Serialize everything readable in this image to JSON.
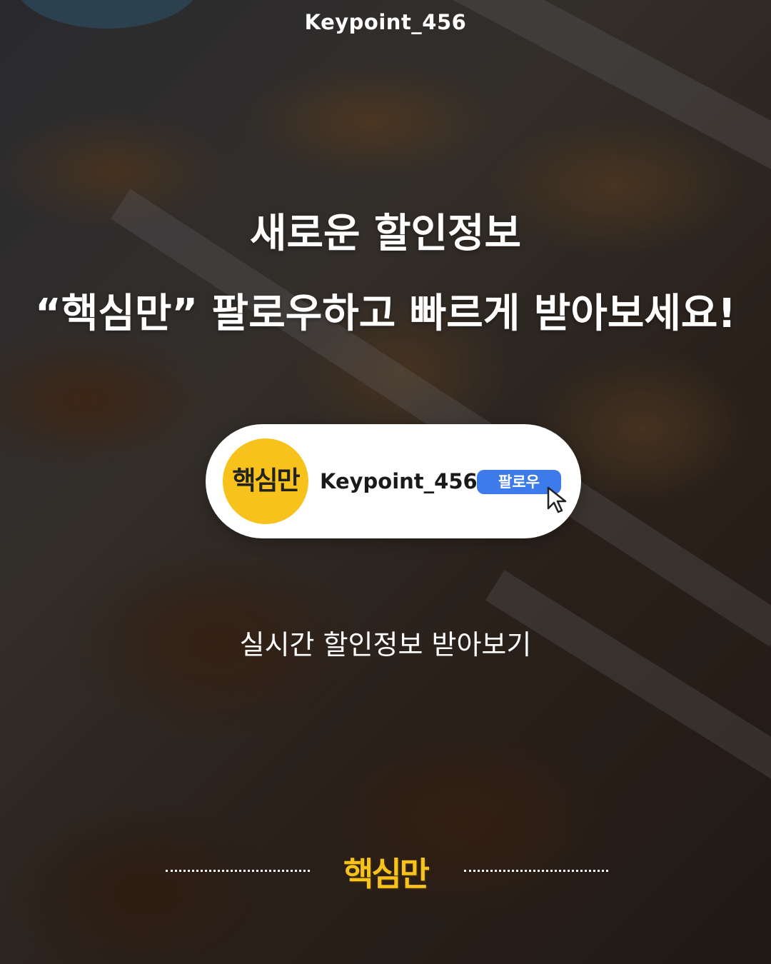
{
  "top": {
    "handle": "Keypoint_456"
  },
  "headline": {
    "line1": "새로운 할인정보",
    "line2": "“핵심만” 팔로우하고 빠르게 받아보세요!"
  },
  "profile_card": {
    "avatar_text": "핵심만",
    "name": "Keypoint_456",
    "follow_label": "팔로우"
  },
  "subtitle": "실시간 할인정보 받아보기",
  "footer": {
    "logo_text": "핵심만"
  },
  "colors": {
    "avatar_bg": "#f7c21b",
    "follow_button": "#3d7bea",
    "logo": "#f7c21b"
  },
  "icons": {
    "cursor": "pointer-cursor-icon"
  }
}
